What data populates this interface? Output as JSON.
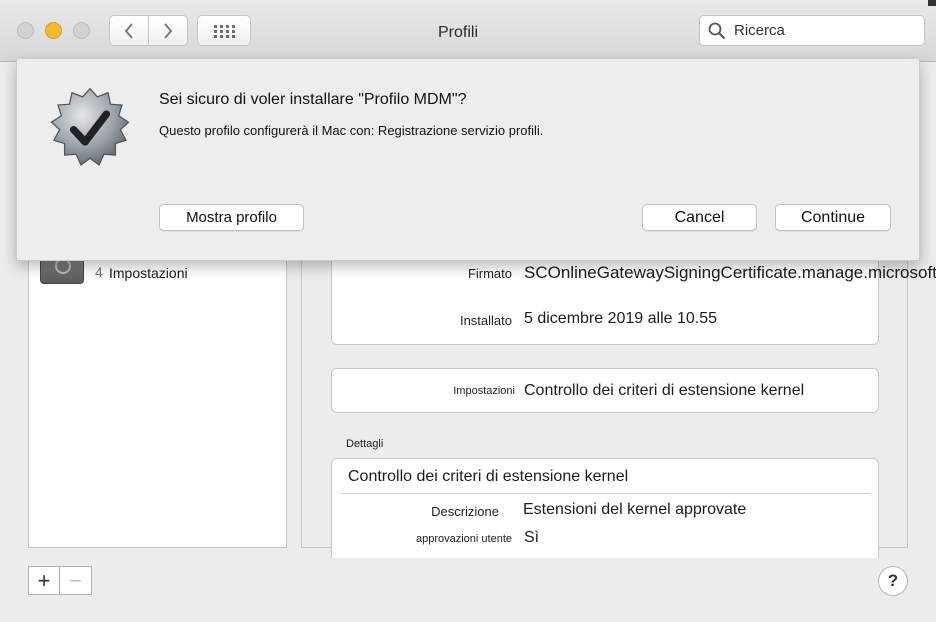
{
  "window": {
    "title": "Profili",
    "search_placeholder": "Ricerca",
    "icons": {
      "back": "chevron-left-icon",
      "forward": "chevron-right-icon",
      "grid": "grid-icon",
      "search": "search-icon"
    }
  },
  "sidebar": {
    "item": {
      "count": "4",
      "label": "Impostazioni"
    }
  },
  "details": {
    "signed_label": "Firmato",
    "signed_value": "SCOnlineGatewaySigningCertificate.manage.microsoft.com",
    "installed_label": "Installato",
    "installed_value": "5 dicembre 2019 alle 10.55",
    "settings_label": "Impostazioni",
    "settings_value": "Controllo dei criteri di estensione kernel",
    "section_heading": "Dettagli",
    "detail_title": "Controllo dei criteri di estensione kernel",
    "description_label": "Descrizione",
    "description_value": "Estensioni del kernel approvate",
    "user_approvals_label": "approvazioni utente",
    "user_approvals_value": "Sì"
  },
  "bottom": {
    "add_label": "+",
    "remove_label": "−",
    "help_label": "?"
  },
  "dialog": {
    "title": "Sei sicuro di voler installare \"Profilo MDM\"?",
    "message": "Questo profilo configurerà il Mac con: Registrazione servizio profili.",
    "show_profile_label": "Mostra profilo",
    "cancel_label": "Cancel",
    "continue_label": "Continue",
    "icon": "verified-badge-icon"
  }
}
